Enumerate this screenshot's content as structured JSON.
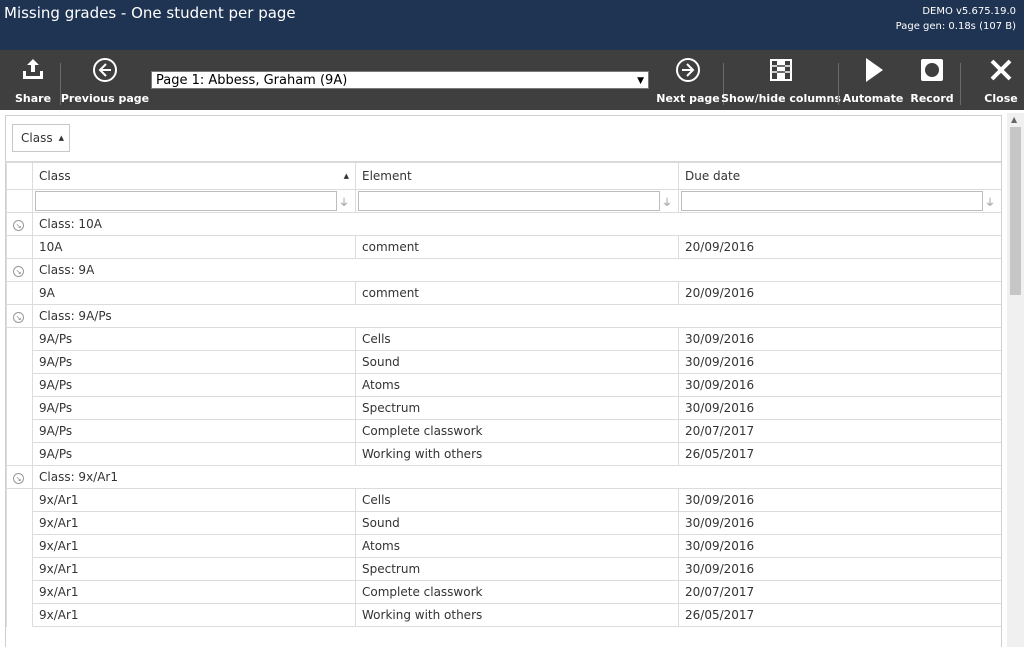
{
  "window": {
    "title": "Missing grades - One student per page",
    "version": "DEMO v5.675.19.0",
    "page_gen": "Page gen: 0.18s (107 B)"
  },
  "toolbar": {
    "share": "Share",
    "previous_page": "Previous page",
    "page_select_value": "Page 1: Abbess, Graham (9A)",
    "next_page": "Next page",
    "show_hide_columns": "Show/hide columns",
    "automate": "Automate",
    "record": "Record",
    "close": "Close"
  },
  "grid": {
    "group_chip": "Class",
    "columns": [
      "Class",
      "Element",
      "Due date"
    ],
    "groups": [
      {
        "label": "Class: 10A",
        "rows": [
          [
            "10A",
            "comment",
            "20/09/2016"
          ]
        ]
      },
      {
        "label": "Class: 9A",
        "rows": [
          [
            "9A",
            "comment",
            "20/09/2016"
          ]
        ]
      },
      {
        "label": "Class: 9A/Ps",
        "rows": [
          [
            "9A/Ps",
            "Cells",
            "30/09/2016"
          ],
          [
            "9A/Ps",
            "Sound",
            "30/09/2016"
          ],
          [
            "9A/Ps",
            "Atoms",
            "30/09/2016"
          ],
          [
            "9A/Ps",
            "Spectrum",
            "30/09/2016"
          ],
          [
            "9A/Ps",
            "Complete classwork",
            "20/07/2017"
          ],
          [
            "9A/Ps",
            "Working with others",
            "26/05/2017"
          ]
        ]
      },
      {
        "label": "Class: 9x/Ar1",
        "rows": [
          [
            "9x/Ar1",
            "Cells",
            "30/09/2016"
          ],
          [
            "9x/Ar1",
            "Sound",
            "30/09/2016"
          ],
          [
            "9x/Ar1",
            "Atoms",
            "30/09/2016"
          ],
          [
            "9x/Ar1",
            "Spectrum",
            "30/09/2016"
          ],
          [
            "9x/Ar1",
            "Complete classwork",
            "20/07/2017"
          ],
          [
            "9x/Ar1",
            "Working with others",
            "26/05/2017"
          ]
        ]
      }
    ]
  }
}
